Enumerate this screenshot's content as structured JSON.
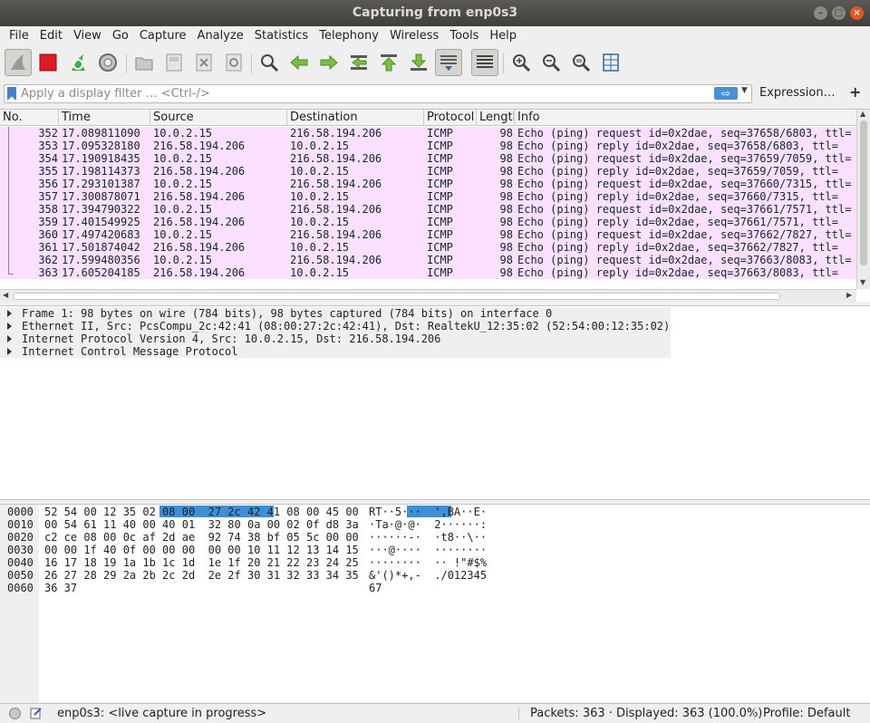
{
  "window": {
    "title": "Capturing from enp0s3",
    "controls": {
      "minimize": "–",
      "maximize": "□",
      "close": "×"
    }
  },
  "menu": [
    "File",
    "Edit",
    "View",
    "Go",
    "Capture",
    "Analyze",
    "Statistics",
    "Telephony",
    "Wireless",
    "Tools",
    "Help"
  ],
  "toolbar": {
    "icons": [
      "shark-fin-start-icon",
      "stop-capture-icon",
      "restart-capture-icon",
      "capture-options-icon",
      "open-file-icon",
      "save-file-icon",
      "close-file-icon",
      "reload-file-icon",
      "find-packet-icon",
      "go-back-icon",
      "go-forward-icon",
      "go-to-packet-icon",
      "go-first-packet-icon",
      "go-last-packet-icon",
      "autoscroll-icon",
      "colorize-icon",
      "zoom-in-icon",
      "zoom-out-icon",
      "normal-size-icon",
      "resize-columns-icon"
    ]
  },
  "filter": {
    "placeholder": "Apply a display filter … <Ctrl-/>",
    "value": "",
    "apply_symbol": "⇨",
    "dropdown_symbol": "▼",
    "expression_label": "Expression…",
    "plus_label": "+"
  },
  "packet_list": {
    "columns": [
      "No.",
      "Time",
      "Source",
      "Destination",
      "Protocol",
      "Length",
      "Info"
    ],
    "row_color": "#fce0ff",
    "rows": [
      {
        "no": "352",
        "time": "17.089811090",
        "src": "10.0.2.15",
        "dst": "216.58.194.206",
        "proto": "ICMP",
        "len": "98",
        "info": "Echo (ping) request  id=0x2dae, seq=37658/6803, ttl="
      },
      {
        "no": "353",
        "time": "17.095328180",
        "src": "216.58.194.206",
        "dst": "10.0.2.15",
        "proto": "ICMP",
        "len": "98",
        "info": "Echo (ping) reply    id=0x2dae, seq=37658/6803, ttl="
      },
      {
        "no": "354",
        "time": "17.190918435",
        "src": "10.0.2.15",
        "dst": "216.58.194.206",
        "proto": "ICMP",
        "len": "98",
        "info": "Echo (ping) request  id=0x2dae, seq=37659/7059, ttl="
      },
      {
        "no": "355",
        "time": "17.198114373",
        "src": "216.58.194.206",
        "dst": "10.0.2.15",
        "proto": "ICMP",
        "len": "98",
        "info": "Echo (ping) reply    id=0x2dae, seq=37659/7059, ttl="
      },
      {
        "no": "356",
        "time": "17.293101387",
        "src": "10.0.2.15",
        "dst": "216.58.194.206",
        "proto": "ICMP",
        "len": "98",
        "info": "Echo (ping) request  id=0x2dae, seq=37660/7315, ttl="
      },
      {
        "no": "357",
        "time": "17.300878071",
        "src": "216.58.194.206",
        "dst": "10.0.2.15",
        "proto": "ICMP",
        "len": "98",
        "info": "Echo (ping) reply    id=0x2dae, seq=37660/7315, ttl="
      },
      {
        "no": "358",
        "time": "17.394790322",
        "src": "10.0.2.15",
        "dst": "216.58.194.206",
        "proto": "ICMP",
        "len": "98",
        "info": "Echo (ping) request  id=0x2dae, seq=37661/7571, ttl="
      },
      {
        "no": "359",
        "time": "17.401549925",
        "src": "216.58.194.206",
        "dst": "10.0.2.15",
        "proto": "ICMP",
        "len": "98",
        "info": "Echo (ping) reply    id=0x2dae, seq=37661/7571, ttl="
      },
      {
        "no": "360",
        "time": "17.497420683",
        "src": "10.0.2.15",
        "dst": "216.58.194.206",
        "proto": "ICMP",
        "len": "98",
        "info": "Echo (ping) request  id=0x2dae, seq=37662/7827, ttl="
      },
      {
        "no": "361",
        "time": "17.501874042",
        "src": "216.58.194.206",
        "dst": "10.0.2.15",
        "proto": "ICMP",
        "len": "98",
        "info": "Echo (ping) reply    id=0x2dae, seq=37662/7827, ttl="
      },
      {
        "no": "362",
        "time": "17.599480356",
        "src": "10.0.2.15",
        "dst": "216.58.194.206",
        "proto": "ICMP",
        "len": "98",
        "info": "Echo (ping) request  id=0x2dae, seq=37663/8083, ttl="
      },
      {
        "no": "363",
        "time": "17.605204185",
        "src": "216.58.194.206",
        "dst": "10.0.2.15",
        "proto": "ICMP",
        "len": "98",
        "info": "Echo (ping) reply    id=0x2dae, seq=37663/8083, ttl="
      }
    ]
  },
  "details": [
    "Frame 1: 98 bytes on wire (784 bits), 98 bytes captured (784 bits) on interface 0",
    "Ethernet II, Src: PcsCompu_2c:42:41 (08:00:27:2c:42:41), Dst: RealtekU_12:35:02 (52:54:00:12:35:02)",
    "Internet Protocol Version 4, Src: 10.0.2.15, Dst: 216.58.194.206",
    "Internet Control Message Protocol"
  ],
  "bytes": {
    "highlight_color": "#3d8fd6",
    "rows": [
      {
        "offset": "0000",
        "hex": "52 54 00 12 35 02 08 00  27 2c 42 41 08 00 45 00",
        "ascii": "RT··5···  ',BA··E·"
      },
      {
        "offset": "0010",
        "hex": "00 54 61 11 40 00 40 01  32 80 0a 00 02 0f d8 3a",
        "ascii": "·Ta·@·@·  2······:"
      },
      {
        "offset": "0020",
        "hex": "c2 ce 08 00 0c af 2d ae  92 74 38 bf 05 5c 00 00",
        "ascii": "······-·  ·t8··\\··"
      },
      {
        "offset": "0030",
        "hex": "00 00 1f 40 0f 00 00 00  00 00 10 11 12 13 14 15",
        "ascii": "···@····  ········"
      },
      {
        "offset": "0040",
        "hex": "16 17 18 19 1a 1b 1c 1d  1e 1f 20 21 22 23 24 25",
        "ascii": "········  ·· !\"#$%"
      },
      {
        "offset": "0050",
        "hex": "26 27 28 29 2a 2b 2c 2d  2e 2f 30 31 32 33 34 35",
        "ascii": "&'()*+,-  ./012345"
      },
      {
        "offset": "0060",
        "hex": "36 37",
        "ascii": "67"
      }
    ]
  },
  "status": {
    "capture_text": "enp0s3: <live capture in progress>",
    "packets_text": "Packets: 363 · Displayed: 363 (100.0%)",
    "profile_text": "Profile: Default"
  }
}
